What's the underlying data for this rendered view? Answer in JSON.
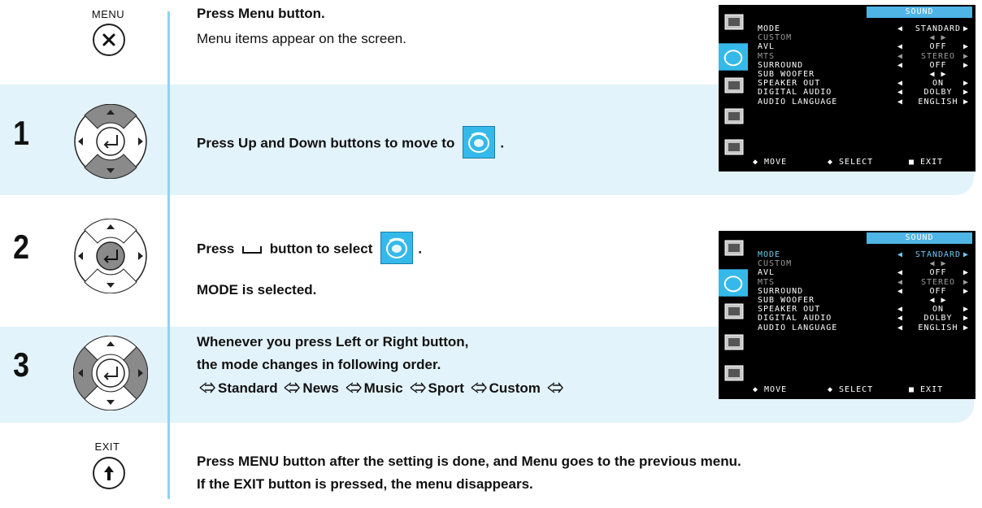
{
  "header": {
    "menu_caption": "MENU",
    "menu_text_1": "Press Menu button.",
    "menu_text_2": "Menu items appear on the screen."
  },
  "steps": [
    {
      "number": "1",
      "text_before": "Press Up and Down buttons to move to",
      "text_after": "."
    },
    {
      "number": "2",
      "text_press": "Press",
      "text_select": "button to select",
      "text_after": ".",
      "note": "MODE is selected."
    },
    {
      "number": "3",
      "line1": "Whenever you press Left or Right button,",
      "line2": "the mode changes in following order.",
      "order": [
        "Standard",
        "News",
        "Music",
        "Sport",
        "Custom"
      ]
    }
  ],
  "footer": {
    "exit_caption": "EXIT",
    "line1": "Press MENU button after the setting is done, and Menu goes to the previous menu.",
    "line2": "If the EXIT button is pressed, the menu disappears."
  },
  "osd": {
    "title": "SOUND",
    "rows": [
      {
        "label": "MODE",
        "value": "STANDARD"
      },
      {
        "label": "CUSTOM",
        "value": ""
      },
      {
        "label": "AVL",
        "value": "OFF"
      },
      {
        "label": "MTS",
        "value": "STEREO"
      },
      {
        "label": "SURROUND",
        "value": "OFF"
      },
      {
        "label": "SUB WOOFER",
        "value": ""
      },
      {
        "label": "SPEAKER OUT",
        "value": "ON"
      },
      {
        "label": "DIGITAL AUDIO",
        "value": "DOLBY"
      },
      {
        "label": "AUDIO LANGUAGE",
        "value": "ENGLISH"
      }
    ],
    "footer": {
      "move": "MOVE",
      "select": "SELECT",
      "exit": "EXIT"
    }
  },
  "colors": {
    "band": "#e3f3fb",
    "rule": "#8fd3ef",
    "osd_accent": "#4fb4e6",
    "icon_blue": "#35b9ea"
  }
}
